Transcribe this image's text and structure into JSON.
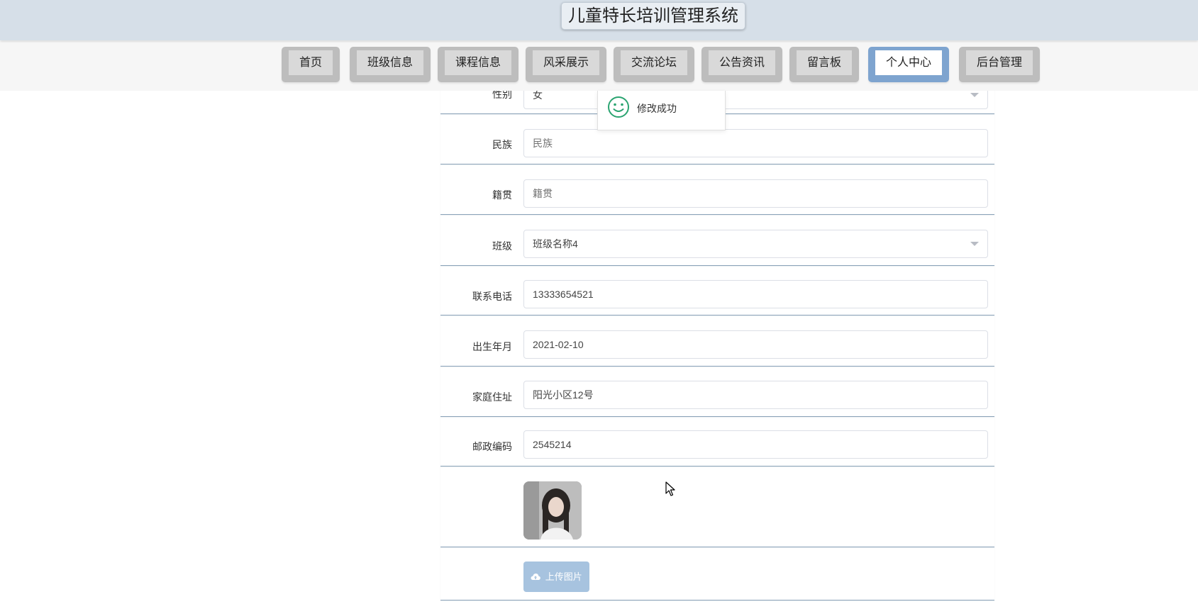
{
  "header": {
    "title": "儿童特长培训管理系统"
  },
  "nav": {
    "items": [
      "首页",
      "班级信息",
      "课程信息",
      "风采展示",
      "交流论坛",
      "公告资讯",
      "留言板",
      "个人中心",
      "后台管理"
    ],
    "active_index": 7,
    "active_color": "#7ea4cf"
  },
  "form": {
    "gender": {
      "label": "性别",
      "value": "女"
    },
    "ethnicity": {
      "label": "民族",
      "placeholder": "民族"
    },
    "native_place": {
      "label": "籍贯",
      "placeholder": "籍贯"
    },
    "class": {
      "label": "班级",
      "value": "班级名称4"
    },
    "phone": {
      "label": "联系电话",
      "value": "13333654521"
    },
    "birth": {
      "label": "出生年月",
      "value": "2021-02-10"
    },
    "address": {
      "label": "家庭住址",
      "value": "阳光小区12号"
    },
    "postcode": {
      "label": "邮政编码",
      "value": "2545214"
    }
  },
  "toast": {
    "message": "修改成功",
    "icon": "smile-icon",
    "color": "#2ba471"
  },
  "upload": {
    "label": "上传图片",
    "icon": "cloud-upload-icon"
  },
  "avatar": {
    "icon": "avatar-photo"
  }
}
